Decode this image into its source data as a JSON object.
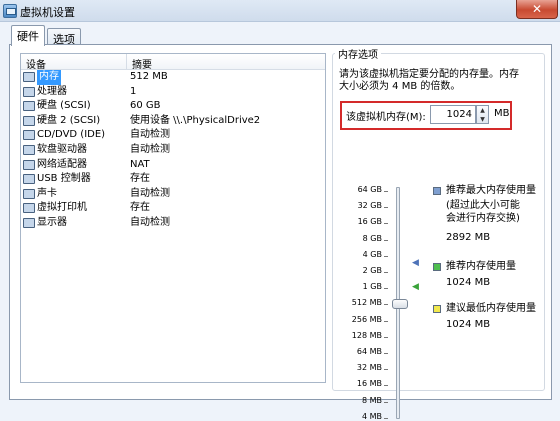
{
  "window": {
    "title": "虚拟机设置",
    "close_glyph": "✕"
  },
  "tabs": [
    {
      "label": "硬件",
      "active": true
    },
    {
      "label": "选项",
      "active": false
    }
  ],
  "device_list": {
    "headers": {
      "device": "设备",
      "summary": "摘要"
    },
    "rows": [
      {
        "name": "内存",
        "summary": "512 MB",
        "icon": "memory-icon",
        "selected": true
      },
      {
        "name": "处理器",
        "summary": "1",
        "icon": "processor-icon"
      },
      {
        "name": "硬盘 (SCSI)",
        "summary": "60 GB",
        "icon": "hard-disk-icon"
      },
      {
        "name": "硬盘 2 (SCSI)",
        "summary": "使用设备 \\\\.\\PhysicalDrive2",
        "icon": "hard-disk-icon"
      },
      {
        "name": "CD/DVD (IDE)",
        "summary": "自动检测",
        "icon": "cd-dvd-icon"
      },
      {
        "name": "软盘驱动器",
        "summary": "自动检测",
        "icon": "floppy-icon"
      },
      {
        "name": "网络适配器",
        "summary": "NAT",
        "icon": "network-adapter-icon"
      },
      {
        "name": "USB 控制器",
        "summary": "存在",
        "icon": "usb-icon"
      },
      {
        "name": "声卡",
        "summary": "自动检测",
        "icon": "sound-card-icon"
      },
      {
        "name": "虚拟打印机",
        "summary": "存在",
        "icon": "printer-icon"
      },
      {
        "name": "显示器",
        "summary": "自动检测",
        "icon": "display-icon"
      }
    ]
  },
  "memory": {
    "group_title": "内存选项",
    "description_line1": "请为该虚拟机指定要分配的内存量。内存",
    "description_line2": "大小必须为 4 MB 的倍数。",
    "field_label": "该虚拟机内存(M):",
    "value": "1024",
    "unit": "MB",
    "scale": [
      "64 GB",
      "32 GB",
      "16 GB",
      "8 GB",
      "4 GB",
      "2 GB",
      "1 GB",
      "512 MB",
      "256 MB",
      "128 MB",
      "64 MB",
      "32 MB",
      "16 MB",
      "8 MB",
      "4 MB"
    ],
    "slider_value": "512 MB",
    "legend": {
      "max": {
        "label": "推荐最大内存使用量",
        "note_line1": "(超过此大小可能",
        "note_line2": "会进行内存交换)",
        "value": "2892 MB",
        "color": "#7f9fd0"
      },
      "recommended": {
        "label": "推荐内存使用量",
        "value": "1024 MB",
        "color": "#4fbf4f"
      },
      "min": {
        "label": "建议最低内存使用量",
        "value": "1024 MB",
        "color": "#f2e94e"
      }
    },
    "arrow_max_color": "#4e73b8",
    "arrow_recommended_color": "#3aa33a"
  }
}
